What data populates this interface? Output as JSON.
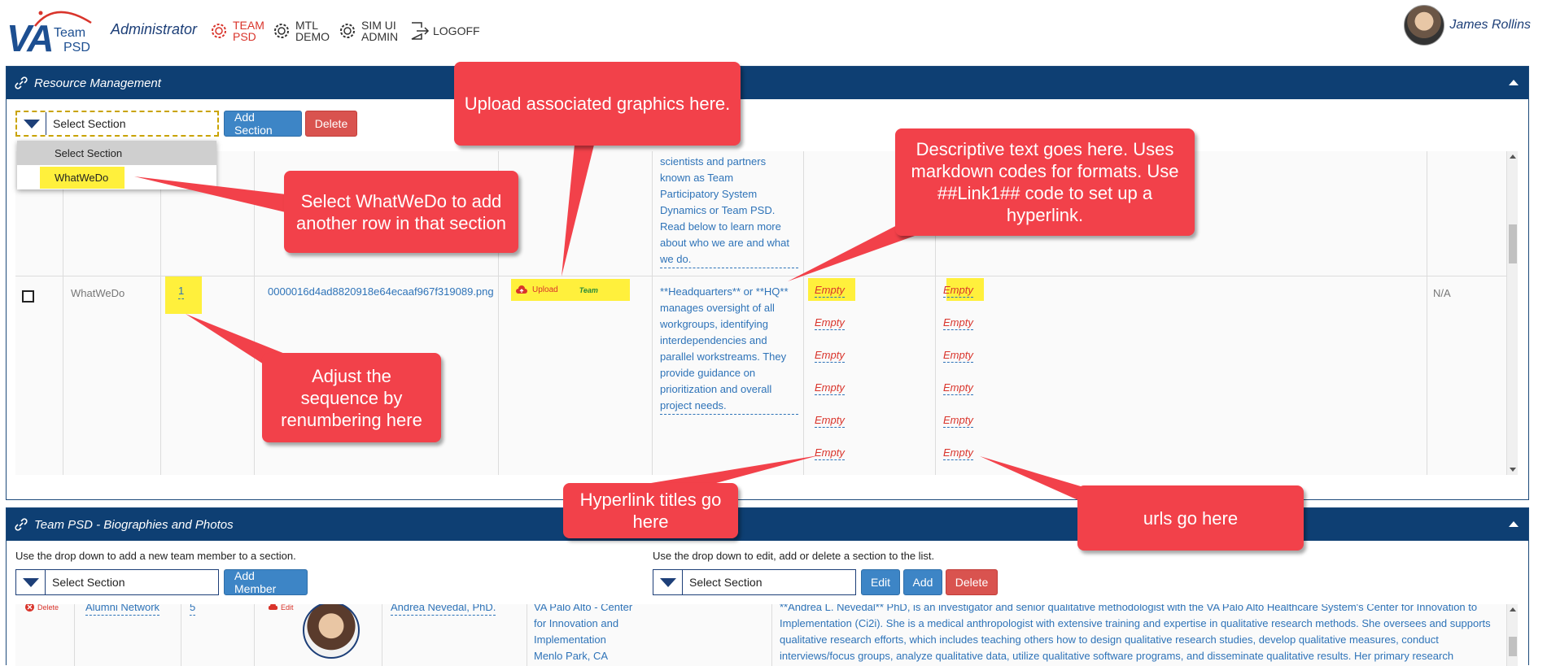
{
  "header": {
    "logo": {
      "va": "VA",
      "team": "Team",
      "psd": "PSD"
    },
    "role": "Administrator",
    "nav": [
      {
        "line1": "TEAM",
        "line2": "PSD",
        "icon": "gear-icon",
        "active": true
      },
      {
        "line1": "MTL",
        "line2": "DEMO",
        "icon": "gear-icon",
        "active": false
      },
      {
        "line1": "SIM UI",
        "line2": "ADMIN",
        "icon": "gear-icon",
        "active": false
      },
      {
        "line1": "LOGOFF",
        "line2": "",
        "icon": "logout-icon",
        "active": false
      }
    ],
    "user_name": "James Rollins"
  },
  "resource_panel": {
    "title": "Resource Management",
    "select_value": "Select Section",
    "add_section_label": "Add Section",
    "delete_label": "Delete",
    "dropdown_options": [
      "Select Section",
      "WhatWeDo"
    ],
    "top_row_description": [
      "scientists and partners",
      "known as Team",
      "Participatory System",
      "Dynamics or Team PSD.",
      "Read below to learn more",
      "about who we are and what",
      "we do."
    ],
    "row": {
      "section": "WhatWeDo",
      "sequence": "1",
      "filename": "0000016d4ad8820918e64ecaaf967f319089.png",
      "upload_label": "Upload",
      "thumb_label": "Team",
      "description": [
        "**Headquarters** or **HQ**",
        "manages oversight of all",
        "workgroups, identifying",
        "interdependencies and",
        "parallel workstreams. They",
        "provide guidance on",
        "prioritization and overall",
        "project needs."
      ],
      "link_titles": [
        "Empty",
        "Empty",
        "Empty",
        "Empty",
        "Empty",
        "Empty"
      ],
      "link_urls": [
        "Empty",
        "Empty",
        "Empty",
        "Empty",
        "Empty",
        "Empty"
      ],
      "na_label": "N/A"
    }
  },
  "bio_panel": {
    "title": "Team PSD - Biographies and Photos",
    "left_help": "Use the drop down to add a new team member to a section.",
    "right_help": "Use the drop down to edit, add or delete a section to the list.",
    "left_select_value": "Select Section",
    "add_member_label": "Add Member",
    "right_select_value": "Select Section",
    "edit_label": "Edit",
    "add_label": "Add",
    "delete_label": "Delete",
    "row": {
      "delete_label": "Delete",
      "section": "Alumni Network",
      "sequence": "5",
      "edit_label": "Edit",
      "name": "Andrea Nevedal, PhD.",
      "affiliation": [
        "VA Palo Alto - Center",
        "for Innovation and",
        "Implementation",
        "Menlo Park, CA"
      ],
      "bio": [
        "**Andrea L. Nevedal** PhD, is an investigator and senior qualitative methodologist with the VA Palo Alto Healthcare System's Center for Innovation to",
        "Implementation (Ci2i). She is a medical anthropologist with extensive training and expertise in qualitative research methods. She oversees and supports",
        "qualitative research efforts, which includes teaching others how to design qualitative research studies, develop qualitative measures, conduct",
        "interviews/focus groups, analyze qualitative data, utilize qualitative software programs, and disseminate qualitative results. Her primary research"
      ]
    }
  },
  "callouts": {
    "upload": "Upload associated graphics here.",
    "descriptive": "Descriptive text goes here. Uses markdown codes for formats. Use ##Link1## code to set up a hyperlink.",
    "select_whatwedo": "Select WhatWeDo to add another row in that section",
    "adjust_sequence": "Adjust the sequence by renumbering here",
    "hyperlink_titles": "Hyperlink titles go here",
    "urls": "urls go here"
  },
  "colors": {
    "header_blue": "#0e3f73",
    "callout_red": "#f2414a",
    "button_blue": "#3d85c6",
    "button_red": "#d9534f",
    "highlight_yellow": "#fff03c",
    "link_blue": "#2e73b8"
  }
}
